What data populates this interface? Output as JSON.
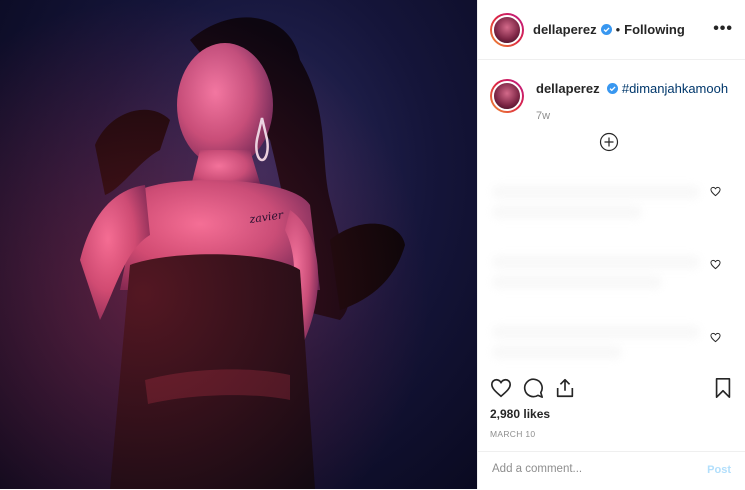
{
  "post": {
    "username": "dellaperez",
    "follow_state": "Following",
    "separator": "•",
    "more_label": "•••"
  },
  "caption": {
    "username": "dellaperez",
    "hashtag": "#dimanjahkamooh",
    "age": "7w"
  },
  "stats": {
    "likes": "2,980 likes",
    "date": "MARCH 10"
  },
  "comment_box": {
    "placeholder": "Add a comment...",
    "post_label": "Post"
  },
  "photo": {
    "tattoo_text": "zavier"
  },
  "colors": {
    "verified": "#3897f0",
    "link": "#00376b",
    "post_disabled": "#b2dffc",
    "muted": "#8e8e8e"
  }
}
